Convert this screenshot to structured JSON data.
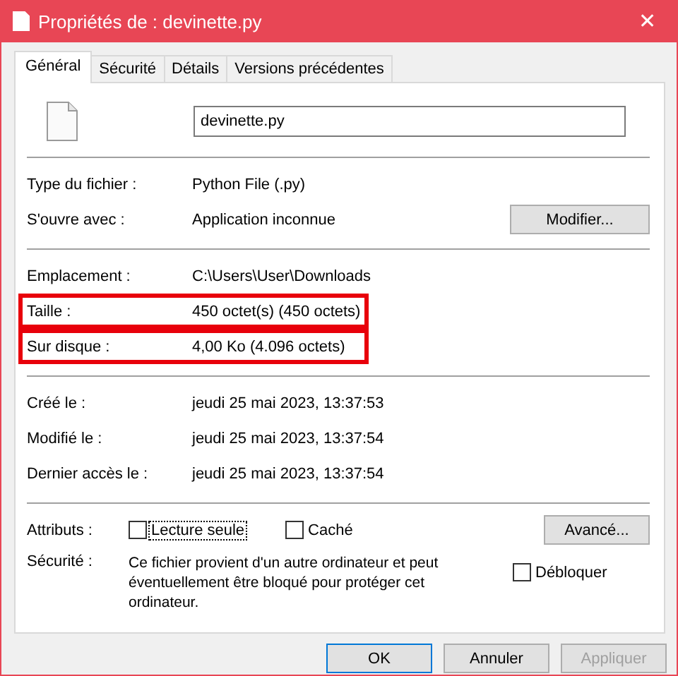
{
  "window": {
    "title": "Propriétés de : devinette.py",
    "close": "✕"
  },
  "tabs": [
    {
      "label": "Général",
      "selected": true
    },
    {
      "label": "Sécurité",
      "selected": false
    },
    {
      "label": "Détails",
      "selected": false
    },
    {
      "label": "Versions précédentes",
      "selected": false
    }
  ],
  "file_name": "devinette.py",
  "sections": [
    [
      {
        "label": "Type du fichier :",
        "value": "Python File (.py)",
        "highlighted": false
      },
      {
        "label": "S'ouvre avec :",
        "value": "Application inconnue",
        "button": "Modifier...",
        "highlighted": false
      }
    ],
    [
      {
        "label": "Emplacement :",
        "value": "C:\\Users\\User\\Downloads",
        "highlighted": false
      },
      {
        "label": "Taille :",
        "value": "450 octet(s) (450 octets)",
        "highlighted": true
      },
      {
        "label": "Sur disque :",
        "value": "4,00 Ko (4.096 octets)",
        "highlighted": true
      }
    ],
    [
      {
        "label": "Créé le :",
        "value": "jeudi 25 mai 2023, 13:37:53",
        "highlighted": false
      },
      {
        "label": "Modifié le :",
        "value": "jeudi 25 mai 2023, 13:37:54",
        "highlighted": false
      },
      {
        "label": "Dernier accès le :",
        "value": "jeudi 25 mai 2023, 13:37:54",
        "highlighted": false
      }
    ]
  ],
  "attributes": {
    "label": "Attributs :",
    "options": [
      {
        "label": "Lecture seule",
        "checked": false,
        "focused": true
      },
      {
        "label": "Caché",
        "checked": false,
        "focused": false
      }
    ],
    "button": "Avancé..."
  },
  "security": {
    "label": "Sécurité :",
    "text": "Ce fichier provient d'un autre ordinateur et peut éventuellement être bloqué pour protéger cet ordinateur.",
    "option": {
      "label": "Débloquer",
      "checked": false
    }
  },
  "buttons": [
    {
      "label": "OK",
      "kind": "default",
      "disabled": false
    },
    {
      "label": "Annuler",
      "kind": "normal",
      "disabled": false
    },
    {
      "label": "Appliquer",
      "kind": "normal",
      "disabled": true
    }
  ]
}
